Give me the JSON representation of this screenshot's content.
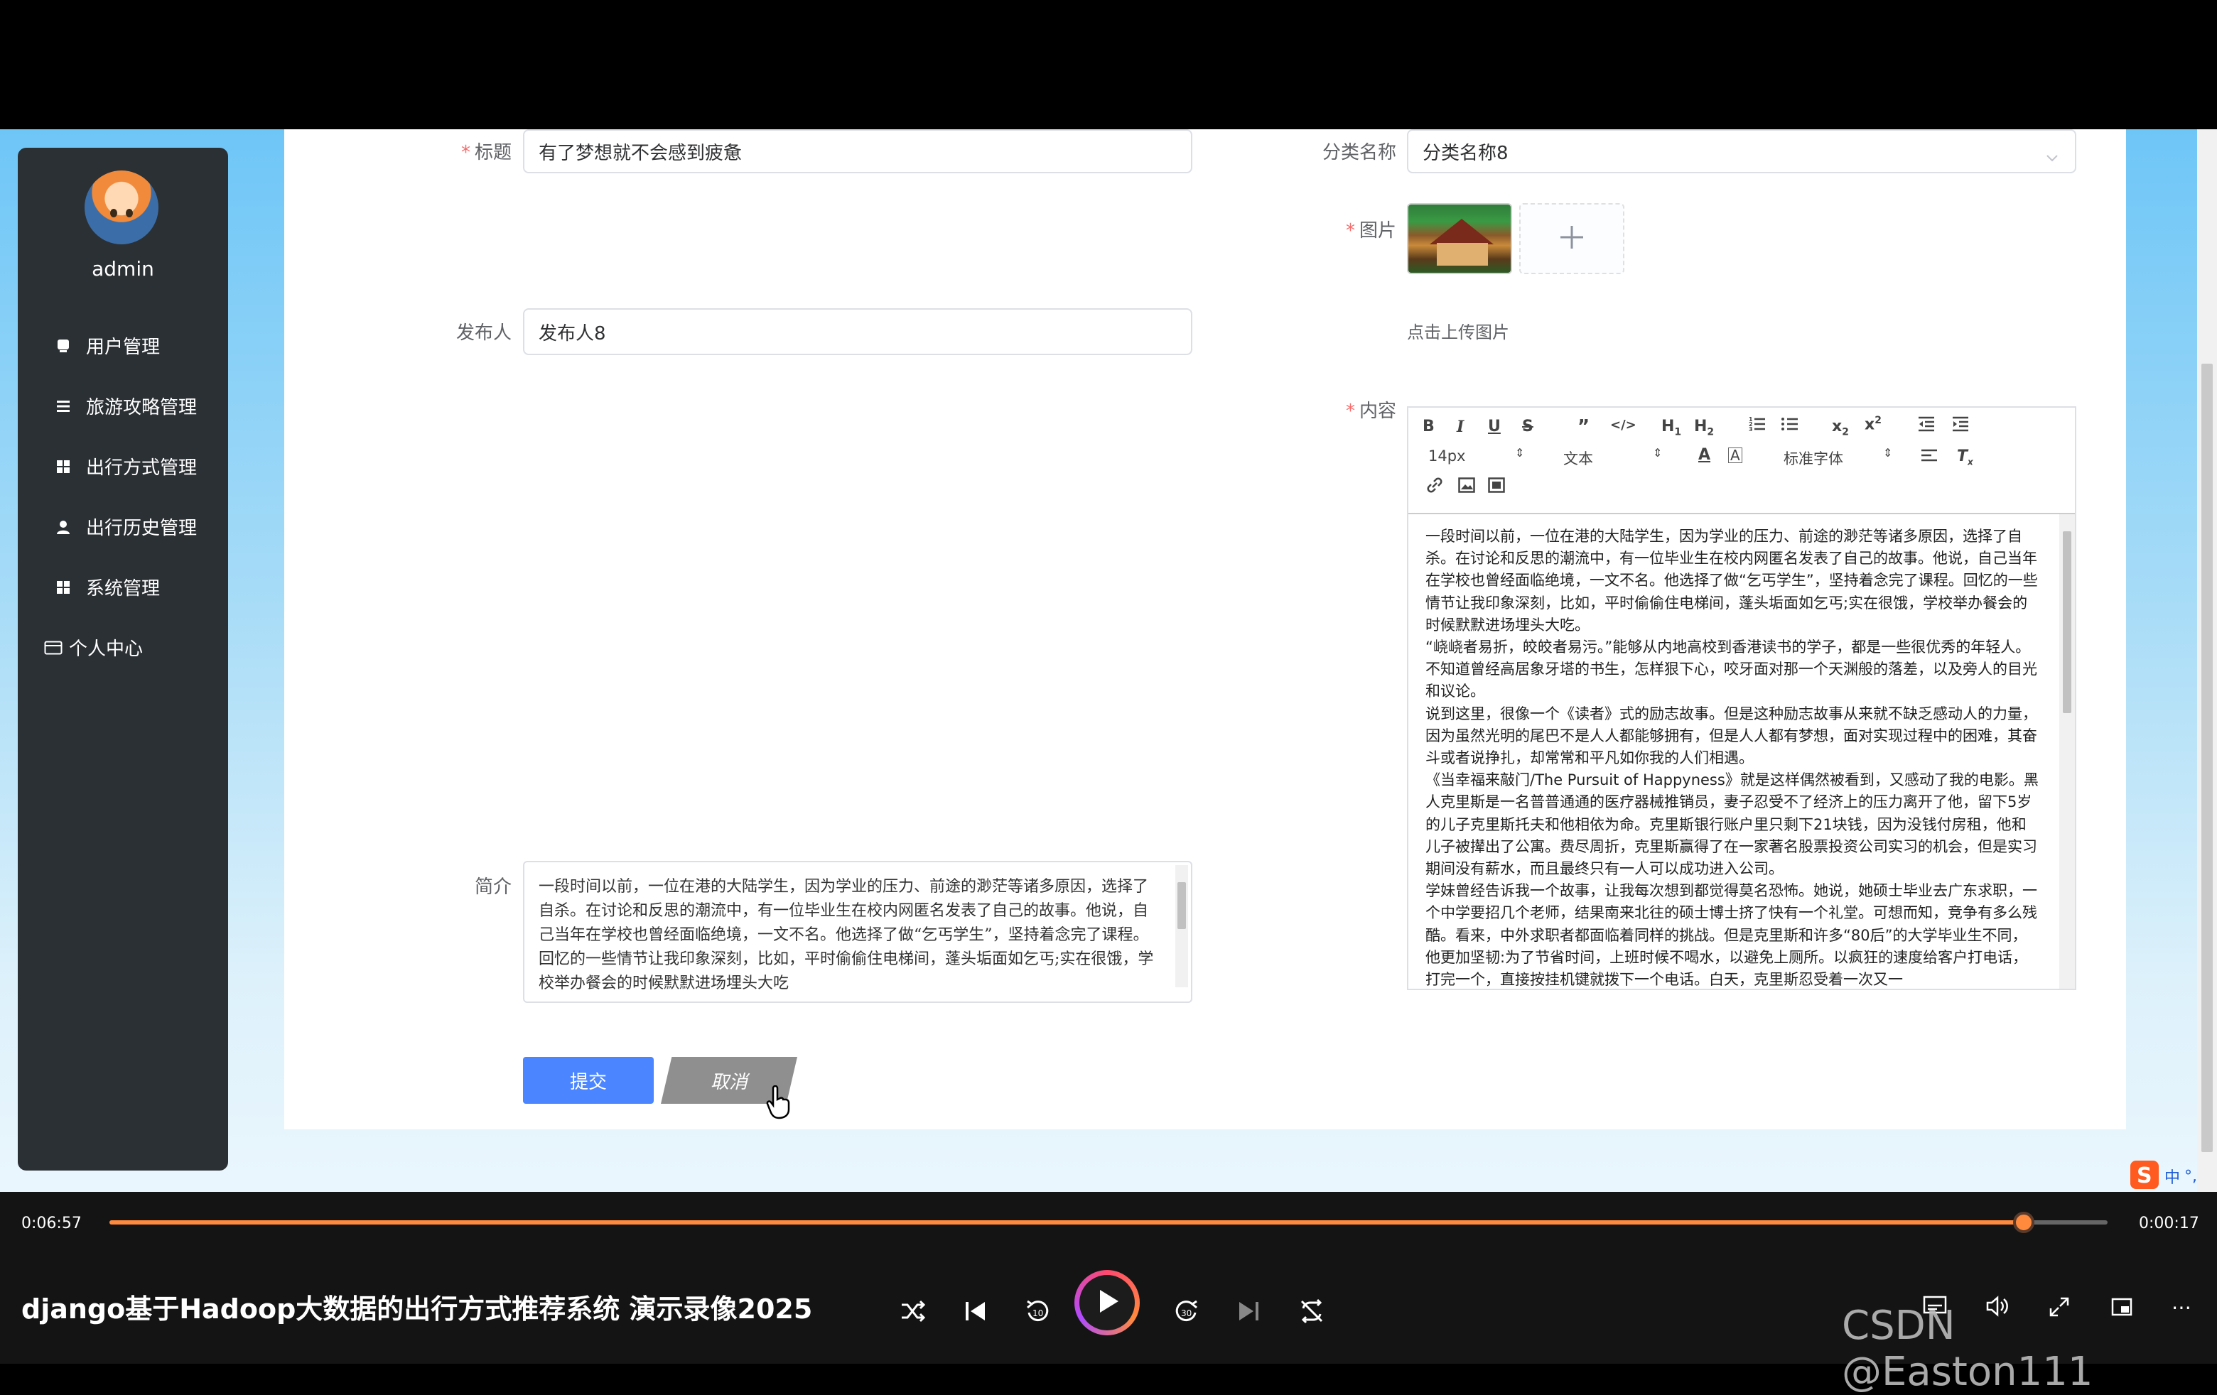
{
  "sidebar": {
    "username": "admin",
    "items": [
      {
        "label": "用户管理",
        "icon": "user-manage-icon"
      },
      {
        "label": "旅游攻略管理",
        "icon": "list-icon"
      },
      {
        "label": "出行方式管理",
        "icon": "grid-icon"
      },
      {
        "label": "出行历史管理",
        "icon": "person-icon"
      },
      {
        "label": "系统管理",
        "icon": "grid-icon"
      },
      {
        "label": "个人中心",
        "icon": "profile-card-icon"
      }
    ]
  },
  "form": {
    "title_label": "标题",
    "title_value": "有了梦想就不会感到疲惫",
    "category_label": "分类名称",
    "category_value": "分类名称8",
    "image_label": "图片",
    "upload_hint": "点击上传图片",
    "publisher_label": "发布人",
    "publisher_value": "发布人8",
    "content_label": "内容",
    "summary_label": "简介",
    "summary_text": "一段时间以前，一位在港的大陆学生，因为学业的压力、前途的渺茫等诸多原因，选择了自杀。在讨论和反思的潮流中，有一位毕业生在校内网匿名发表了自己的故事。他说，自己当年在学校也曾经面临绝境，一文不名。他选择了做“乞丐学生”，坚持着念完了课程。回忆的一些情节让我印象深刻，比如，平时偷偷住电梯间，蓬头垢面如乞丐;实在很饿，学校举办餐会的时候默默进场埋头大吃",
    "submit_label": "提交",
    "cancel_label": "取消"
  },
  "editor": {
    "toolbar": {
      "font_size": "14px",
      "block_format": "文本",
      "font_family": "标准字体"
    },
    "paragraphs": [
      "一段时间以前，一位在港的大陆学生，因为学业的压力、前途的渺茫等诸多原因，选择了自杀。在讨论和反思的潮流中，有一位毕业生在校内网匿名发表了自己的故事。他说，自己当年在学校也曾经面临绝境，一文不名。他选择了做“乞丐学生”，坚持着念完了课程。回忆的一些情节让我印象深刻，比如，平时偷偷住电梯间，蓬头垢面如乞丐;实在很饿，学校举办餐会的时候默默进场埋头大吃。",
      "“峣峣者易折，皎皎者易污。”能够从内地高校到香港读书的学子，都是一些很优秀的年轻人。不知道曾经高居象牙塔的书生，怎样狠下心，咬牙面对那一个天渊般的落差，以及旁人的目光和议论。",
      "说到这里，很像一个《读者》式的励志故事。但是这种励志故事从来就不缺乏感动人的力量，因为虽然光明的尾巴不是人人都能够拥有，但是人人都有梦想，面对实现过程中的困难，其奋斗或者说挣扎，却常常和平凡如你我的人们相遇。",
      "《当幸福来敲门/The Pursuit of Happyness》就是这样偶然被看到，又感动了我的电影。黑人克里斯是一名普普通通的医疗器械推销员，妻子忍受不了经济上的压力离开了他，留下5岁的儿子克里斯托夫和他相依为命。克里斯银行账户里只剩下21块钱，因为没钱付房租，他和儿子被撵出了公寓。费尽周折，克里斯赢得了在一家著名股票投资公司实习的机会，但是实习期间没有薪水，而且最终只有一人可以成功进入公司。",
      "学妹曾经告诉我一个故事，让我每次想到都觉得莫名恐怖。她说，她硕士毕业去广东求职，一个中学要招几个老师，结果南来北往的硕士博士挤了快有一个礼堂。可想而知，竞争有多么残酷。看来，中外求职者都面临着同样的挑战。但是克里斯和许多“80后”的大学毕业生不同，他更加坚韧:为了节省时间，上班时候不喝水，以避免上厕所。以疯狂的速度给客户打电话，打完一个，直接按挂机键就拨下一个电话。白天，克里斯忍受着一次又一"
    ]
  },
  "player": {
    "elapsed": "0:06:57",
    "remaining": "0:00:17",
    "progress": 0.958,
    "title": "django基于Hadoop大数据的出行方式推荐系统 演示录像2025",
    "accent": "#ff8a3d"
  },
  "ime": {
    "label": "中"
  },
  "watermark": "CSDN @Easton111"
}
